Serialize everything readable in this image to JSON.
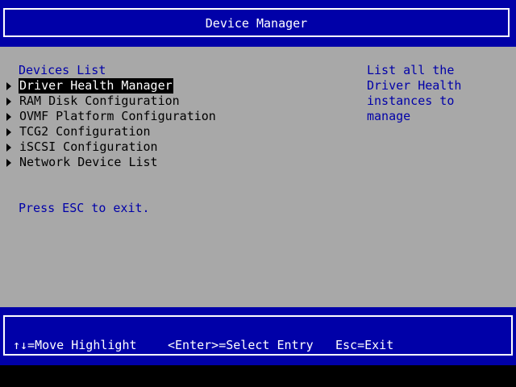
{
  "window": {
    "title": "Device Manager"
  },
  "main": {
    "list_header": "Devices List",
    "items": [
      {
        "label": "Driver Health Manager",
        "selected": true
      },
      {
        "label": "RAM Disk Configuration",
        "selected": false
      },
      {
        "label": "OVMF Platform Configuration",
        "selected": false
      },
      {
        "label": "TCG2 Configuration",
        "selected": false
      },
      {
        "label": "iSCSI Configuration",
        "selected": false
      },
      {
        "label": "Network Device List",
        "selected": false
      }
    ],
    "esc_hint": "Press ESC to exit."
  },
  "help": {
    "text": "List all the Driver Health instances to manage"
  },
  "footer": {
    "move": "↑↓=Move Highlight",
    "select": "<Enter>=Select Entry",
    "exit": "Esc=Exit"
  },
  "colors": {
    "band_blue": "#0000a8",
    "body_gray": "#a8a8a8",
    "text_blue": "#0000a8",
    "highlight_bg": "#000000",
    "highlight_fg": "#ffffff"
  },
  "icons": {
    "menu_item_marker": "triangle-right-icon"
  }
}
